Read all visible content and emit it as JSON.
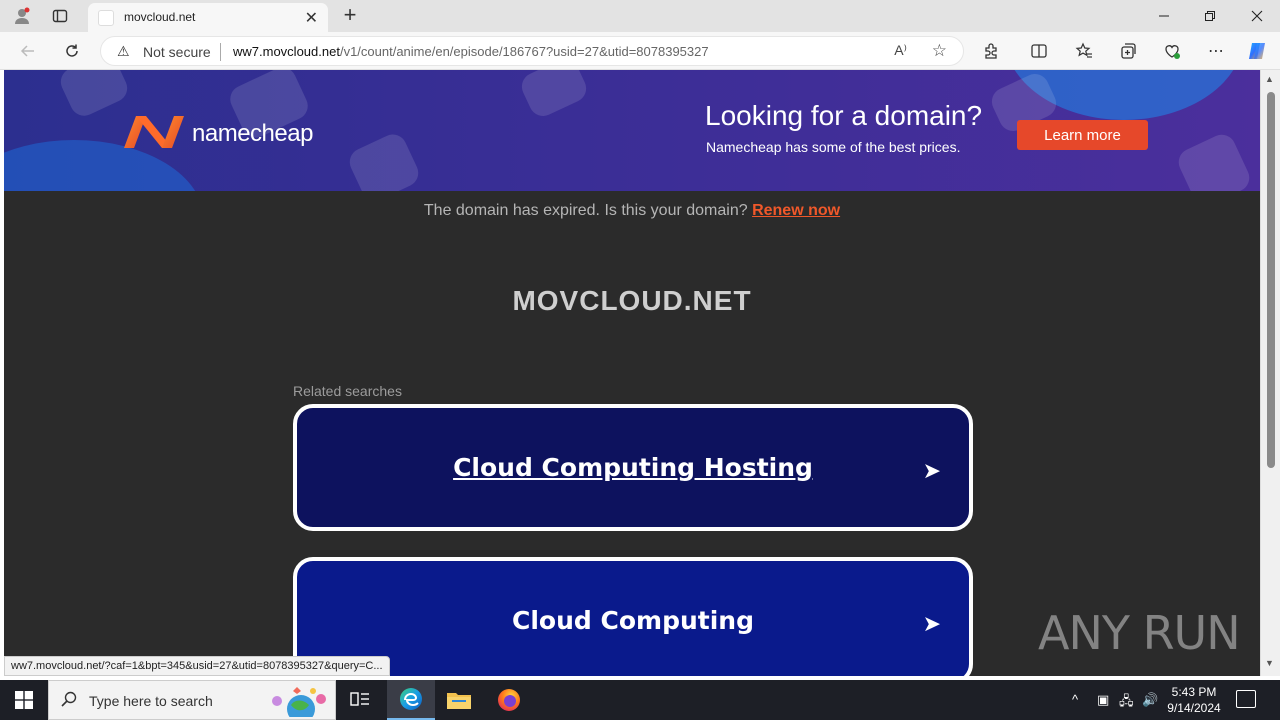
{
  "browser": {
    "tab_title": "movcloud.net",
    "security_label": "Not secure",
    "url_host": "ww7.movcloud.net",
    "url_path": "/v1/count/anime/en/episode/186767?usid=27&utid=8078395327",
    "status_url": "ww7.movcloud.net/?caf=1&bpt=345&usid=27&utid=8078395327&query=C..."
  },
  "banner": {
    "brand": "namecheap",
    "headline": "Looking for a domain?",
    "subline": "Namecheap has some of the best prices.",
    "cta": "Learn more",
    "brand_color": "#e6482a"
  },
  "page": {
    "expired_text": "The domain has expired. Is this your domain?",
    "renew_link": "Renew now",
    "domain_title": "MOVCLOUD.NET",
    "related_label": "Related searches",
    "results": [
      {
        "label": "Cloud Computing Hosting"
      },
      {
        "label": "Cloud Computing"
      }
    ],
    "watermark": "ANY RUN"
  },
  "taskbar": {
    "search_placeholder": "Type here to search",
    "time": "5:43 PM",
    "date": "9/14/2024"
  },
  "icons": [
    "profile-icon",
    "tab-actions-icon",
    "close-tab-icon",
    "new-tab-icon",
    "minimize-icon",
    "restore-icon",
    "close-window-icon",
    "back-icon",
    "refresh-icon",
    "warning-icon",
    "read-aloud-icon",
    "favorite-star-icon",
    "extensions-icon",
    "split-screen-icon",
    "favorites-icon",
    "collections-icon",
    "browser-essentials-icon",
    "more-icon",
    "copilot-icon",
    "windows-start-icon",
    "search-icon",
    "task-view-icon",
    "edge-icon",
    "file-explorer-icon",
    "firefox-icon"
  ]
}
